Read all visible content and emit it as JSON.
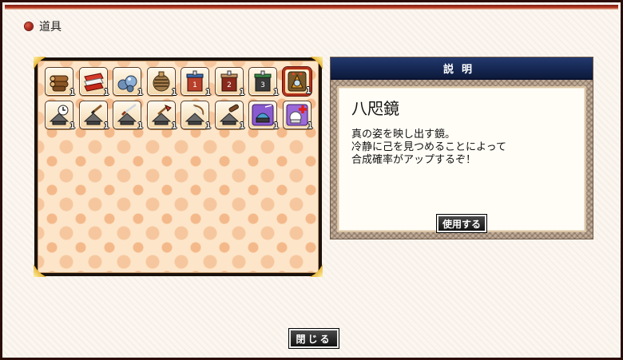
{
  "window": {
    "title": "道具"
  },
  "inventory": {
    "items": [
      {
        "icon": "logs-icon",
        "qty": "1",
        "selected": false
      },
      {
        "icon": "red-cloth-icon",
        "qty": "1",
        "selected": false
      },
      {
        "icon": "water-drops-icon",
        "qty": "1",
        "selected": false
      },
      {
        "icon": "rope-bundle-icon",
        "qty": "1",
        "selected": false
      },
      {
        "icon": "blue-box-icon",
        "qty": "1",
        "selected": false
      },
      {
        "icon": "brown-box-icon",
        "qty": "1",
        "selected": false
      },
      {
        "icon": "green-box-icon",
        "qty": "1",
        "selected": false
      },
      {
        "icon": "mirror-icon",
        "qty": "1",
        "selected": true
      },
      {
        "icon": "clock-hat-icon",
        "qty": "1",
        "selected": false
      },
      {
        "icon": "brush-hat-icon",
        "qty": "1",
        "selected": false
      },
      {
        "icon": "sword-hat-icon",
        "qty": "1",
        "selected": false
      },
      {
        "icon": "axe-hat-icon",
        "qty": "1",
        "selected": false
      },
      {
        "icon": "bow-hat-icon",
        "qty": "1",
        "selected": false
      },
      {
        "icon": "cannon-hat-icon",
        "qty": "1",
        "selected": false
      },
      {
        "icon": "purple-helmet-icon",
        "qty": "1",
        "selected": false
      },
      {
        "icon": "heal-head-icon",
        "qty": "1",
        "selected": false
      }
    ]
  },
  "description": {
    "header": "説明",
    "item_name": "八咫鏡",
    "lines": [
      "真の姿を映し出す鏡。",
      "冷静に己を見つめることによって",
      "合成確率がアップするぞ！"
    ],
    "use_button": "使用する"
  },
  "footer": {
    "close_button": "閉じる"
  }
}
